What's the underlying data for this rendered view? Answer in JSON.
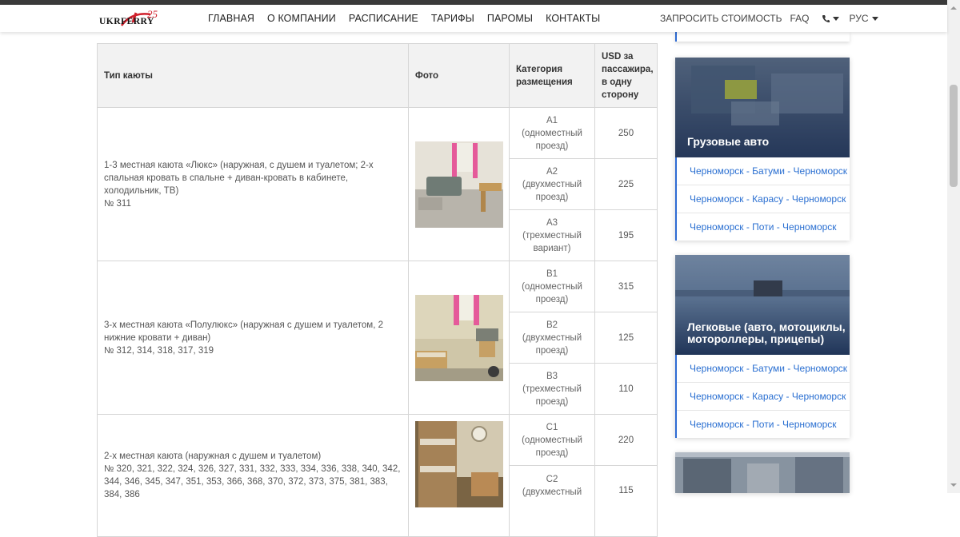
{
  "header": {
    "logo_text": "UKRFERRY",
    "logo_num": "25",
    "nav": [
      "ГЛАВНАЯ",
      "О КОМПАНИИ",
      "РАСПИСАНИЕ",
      "ТАРИФЫ",
      "ПАРОМЫ",
      "КОНТАКТЫ"
    ],
    "request_price": "ЗАПРОСИТЬ СТОИМОСТЬ",
    "faq": "FAQ",
    "phone_icon": "phone-icon",
    "lang": "РУС"
  },
  "table": {
    "headers": {
      "type": "Тип каюты",
      "photo": "Фото",
      "category": "Категория размещения",
      "price": "USD за пассажира, в одну сторону"
    },
    "groups": [
      {
        "type_line1": "1-3 местная каюта «Люкс» (наружная, с душем и туалетом; 2-х спальная кровать в спальне + диван-кровать в кабинете, холодильник, ТВ)",
        "type_line2": "№ 311",
        "rows": [
          {
            "cat": "A1",
            "desc": "(одноместный проезд)",
            "price": "250"
          },
          {
            "cat": "A2",
            "desc": "(двухместный проезд)",
            "price": "225"
          },
          {
            "cat": "A3",
            "desc": "(трехместный вариант)",
            "price": "195"
          }
        ]
      },
      {
        "type_line1": "3-х местная каюта «Полулюкс» (наружная с душем и туалетом, 2 нижние кровати + диван)",
        "type_line2": "№ 312, 314, 318, 317, 319",
        "rows": [
          {
            "cat": "B1",
            "desc": "(одноместный проезд)",
            "price": "315"
          },
          {
            "cat": "B2",
            "desc": "(двухместный проезд)",
            "price": "125"
          },
          {
            "cat": "B3",
            "desc": "(трехместный проезд)",
            "price": "110"
          }
        ]
      },
      {
        "type_line1": "2-х местная каюта (наружная с душем и туалетом)",
        "type_line2": "№ 320, 321, 322, 324, 326, 327, 331, 332, 333, 334, 336, 338, 340, 342, 344, 346, 345, 347, 351, 353, 366, 368, 370, 372, 373, 375, 381, 383, 384, 386",
        "rows": [
          {
            "cat": "C1",
            "desc": "(одноместный проезд)",
            "price": "220"
          },
          {
            "cat": "C2",
            "desc": "(двухместный",
            "price": "115"
          }
        ]
      }
    ]
  },
  "sidebar": {
    "cards": [
      {
        "title": "Грузовые авто",
        "links": [
          "Черноморск - Батуми - Черноморск",
          "Черноморск - Карасу - Черноморск",
          "Черноморск - Поти - Черноморск"
        ]
      },
      {
        "title": "Легковые (авто, мотоциклы, мотороллеры, прицепы)",
        "links": [
          "Черноморск - Батуми - Черноморск",
          "Черноморск - Карасу - Черноморск",
          "Черноморск - Поти - Черноморск"
        ]
      }
    ]
  }
}
